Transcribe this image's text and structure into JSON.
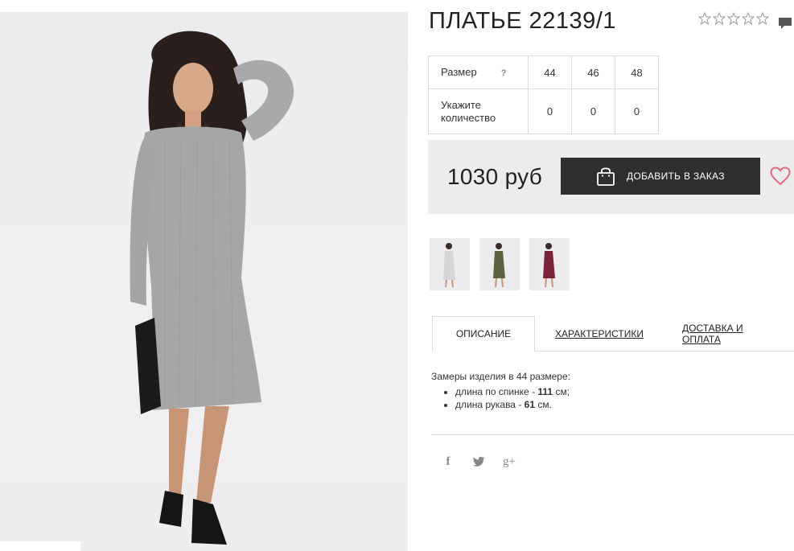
{
  "product": {
    "title": "ПЛАТЬЕ 22139/1",
    "rating_stars": 5,
    "price": "1030 руб",
    "add_to_order_label": "ДОБАВИТЬ В ЗАКАЗ"
  },
  "sizes_table": {
    "size_label": "Размер",
    "help_mark": "?",
    "quantity_label_line1": "Укажите",
    "quantity_label_line2": "количество",
    "sizes": [
      "44",
      "46",
      "48"
    ],
    "quantities": [
      "0",
      "0",
      "0"
    ]
  },
  "thumbnails": [
    {
      "color_name": "grey",
      "dress_color": "#d6d6d8"
    },
    {
      "color_name": "olive",
      "dress_color": "#5b6340"
    },
    {
      "color_name": "burgundy",
      "dress_color": "#7a2438"
    }
  ],
  "tabs": [
    {
      "label": "ОПИСАНИЕ",
      "active": true
    },
    {
      "label": "ХАРАКТЕРИСТИКИ",
      "active": false
    },
    {
      "label": "ДОСТАВКА И ОПЛАТА",
      "active": false
    }
  ],
  "description": {
    "intro": "Замеры изделия в 44 размере:",
    "items": [
      {
        "prefix": "длина по спинке - ",
        "value": "111",
        "suffix": " см;"
      },
      {
        "prefix": "длина рукава - ",
        "value": "61",
        "suffix": " см."
      }
    ]
  },
  "social": {
    "facebook_glyph": "f",
    "twitter_icon": "twitter-icon",
    "gplus_glyph": "g+"
  },
  "colors": {
    "button_bg": "#2f2f2f",
    "price_box_bg": "#ececec",
    "heart": "#e0697f",
    "border": "#dcdcdc"
  }
}
